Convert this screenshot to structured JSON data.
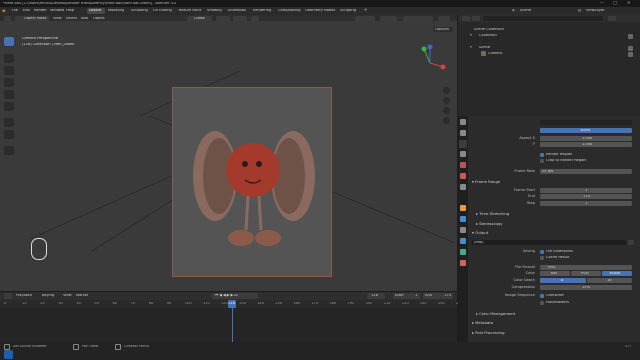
{
  "window": {
    "title": "*Hard ball [C:\\Users\\mihail\\Desktop\\render transparency\\Hard Ball\\hard ball.blend] - Blender 4.0"
  },
  "menu": [
    "File",
    "Edit",
    "Render",
    "Window",
    "Help"
  ],
  "workspaces": [
    "Layout",
    "Modeling",
    "Sculpting",
    "UV Editing",
    "Texture Paint",
    "Shading",
    "Animation",
    "Rendering",
    "Compositing",
    "Geometry Nodes",
    "Scripting"
  ],
  "topright": {
    "scene": "Scene",
    "viewlayer": "ViewLayer"
  },
  "header": {
    "mode": "Object Mode",
    "menus": [
      "View",
      "Select",
      "Add",
      "Object"
    ],
    "orientation": "Global",
    "options": "Options"
  },
  "viewport": {
    "camera_label": "Camera Perspective",
    "collection_label": "(116) Collection | Mah_Shoes"
  },
  "outliner": {
    "scene_collection": "Scene Collection",
    "items": [
      "Collection",
      "Scene",
      "Camera"
    ]
  },
  "props": {
    "colors": {
      "accent": "#4772b3",
      "active_tab": "#3c3c3c",
      "field": "#545454",
      "panel": "#2b2b2b"
    },
    "resolution_percent": "100%",
    "aspect_x": "1.000",
    "aspect_y": "1.000",
    "render_region": "Render Region",
    "crop": "Crop to Render Region",
    "frame_rate_label": "Frame Rate",
    "frame_rate": "24 fps",
    "frame_range": "Frame Range",
    "frame_start_label": "Frame Start",
    "frame_start": "1",
    "end_label": "End",
    "end": "174",
    "step_label": "Step",
    "step": "1",
    "time_stretching": "Time Stretching",
    "stereoscopy": "Stereoscopy",
    "output": "Output",
    "output_path": "/tmp\\",
    "saving_label": "Saving",
    "file_ext": "File Extensions",
    "cache_result": "Cache Result",
    "file_format_label": "File Format",
    "file_format": "PNG",
    "color_label": "Color",
    "color_opts": [
      "BW",
      "RGB",
      "RGBA"
    ],
    "depth_label": "Color Depth",
    "depth_opts": [
      "8",
      "16"
    ],
    "compression_label": "Compression",
    "compression": "15%",
    "img_seq_label": "Image Sequence",
    "overwrite": "Overwrite",
    "placeholders": "Placeholders",
    "color_mgmt": "Color Management",
    "metadata": "Metadata",
    "post": "Post Processing"
  },
  "timeline": {
    "menus": [
      "Playback",
      "Keying",
      "View",
      "Marker"
    ],
    "current_frame": "116",
    "start_label": "Start",
    "start": "1",
    "end_label": "End",
    "end": "174",
    "ticks": [
      "0",
      "10",
      "20",
      "30",
      "40",
      "50",
      "60",
      "70",
      "80",
      "90",
      "100",
      "110",
      "116",
      "120",
      "130",
      "140",
      "150",
      "160",
      "170",
      "180",
      "190",
      "200",
      "210",
      "220",
      "230",
      "240",
      "250"
    ]
  },
  "statusbar": {
    "items": [
      "Set Active Modifier",
      "Pan View",
      "Context Menu"
    ],
    "version": "4.0"
  }
}
